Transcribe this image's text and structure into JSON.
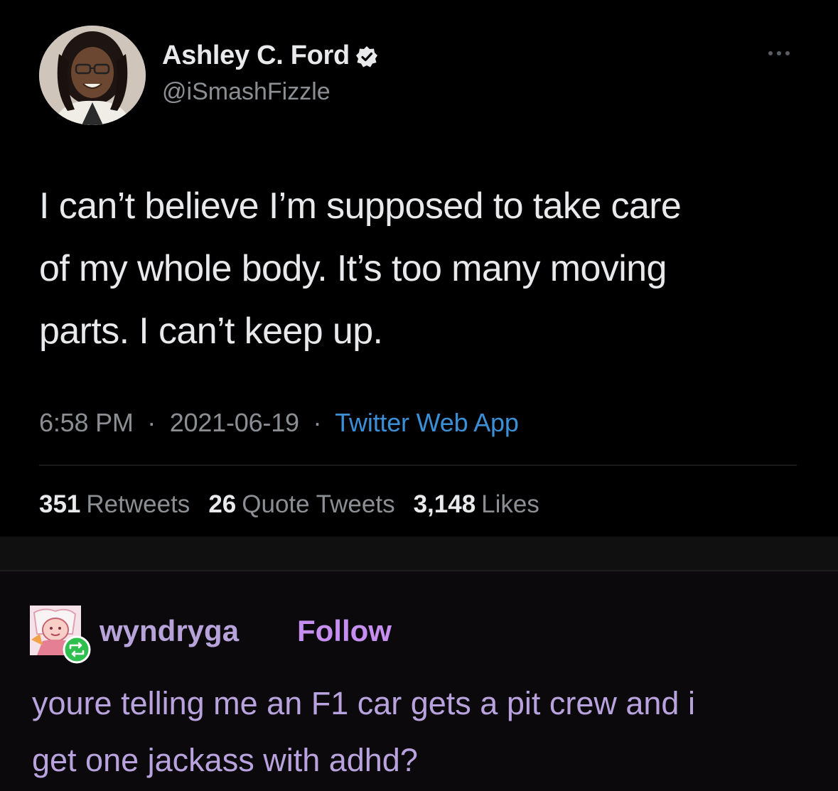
{
  "tweet": {
    "display_name": "Ashley C. Ford",
    "handle": "@iSmashFizzle",
    "text_lines": [
      "I can’t believe I’m supposed to take care",
      "of my whole body. It’s too many moving",
      "parts. I can’t keep up."
    ],
    "time": "6:58 PM",
    "date": "2021-06-19",
    "separator": "·",
    "source": "Twitter Web App",
    "stats": {
      "retweets_count": "351",
      "retweets_label": "Retweets",
      "quote_count": "26",
      "quote_label": "Quote Tweets",
      "likes_count": "3,148",
      "likes_label": "Likes"
    },
    "icons": {
      "verified": "verified-badge-icon",
      "more": "more-options-icon"
    }
  },
  "reblog": {
    "blog_name": "wyndryga",
    "follow_label": "Follow",
    "text_lines": [
      "youre telling me an F1 car gets a pit crew and i",
      "get one jackass with adhd?"
    ],
    "icons": {
      "reblog": "reblog-icon"
    }
  },
  "colors": {
    "background": "#000000",
    "tweet_text": "#e7e9ea",
    "muted": "#8b8f94",
    "source_link": "#3b8fd6",
    "blog_name": "#b7a3da",
    "follow": "#c68ef0",
    "reblog_badge": "#2fbf4f"
  }
}
